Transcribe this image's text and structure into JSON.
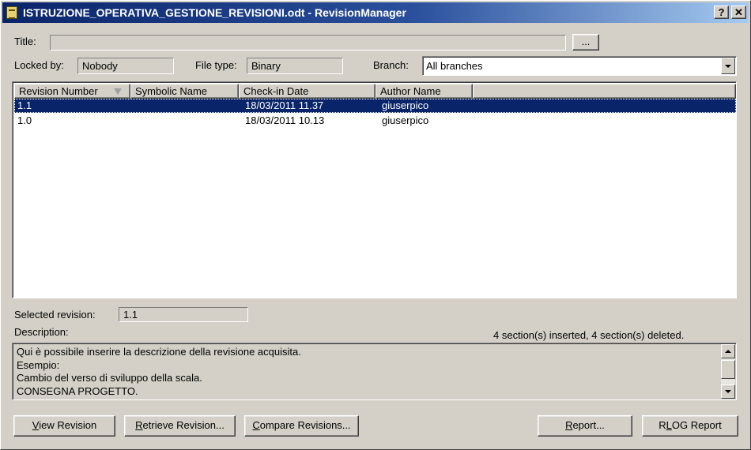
{
  "window": {
    "title": "ISTRUZIONE_OPERATIVA_GESTIONE_REVISIONI.odt - RevisionManager",
    "help_label": "?",
    "close_label": "✕"
  },
  "fields": {
    "title_label": "Title:",
    "title_value": "",
    "browse_label": "...",
    "locked_by_label": "Locked by:",
    "locked_by_value": "Nobody",
    "file_type_label": "File type:",
    "file_type_value": "Binary",
    "branch_label": "Branch:",
    "branch_value": "All branches"
  },
  "revisions": {
    "columns": [
      "Revision Number",
      "Symbolic Name",
      "Check-in Date",
      "Author Name"
    ],
    "rows": [
      {
        "revision": "1.1",
        "symbolic": "",
        "date": "18/03/2011 11.37",
        "author": "giuserpico",
        "selected": true
      },
      {
        "revision": "1.0",
        "symbolic": "",
        "date": "18/03/2011 10.13",
        "author": "giuserpico",
        "selected": false
      }
    ]
  },
  "selection": {
    "selected_revision_label": "Selected revision:",
    "selected_revision_value": "1.1",
    "description_label": "Description:",
    "changes_summary": "4 section(s) inserted, 4 section(s) deleted.",
    "description_lines": [
      "Qui è possibile inserire la descrizione della revisione acquisita.",
      "Esempio:",
      "Cambio del verso di sviluppo della scala.",
      "CONSEGNA PROGETTO."
    ]
  },
  "buttons": {
    "view_revision_acc": "V",
    "view_revision_rest": "iew Revision",
    "retrieve_revision_acc": "R",
    "retrieve_revision_rest": "etrieve Revision...",
    "compare_revisions_acc": "C",
    "compare_revisions_rest": "ompare Revisions...",
    "report_acc": "R",
    "report_rest": "eport...",
    "rlog_report_pre": "R",
    "rlog_report_acc": "L",
    "rlog_report_rest": "OG Report"
  }
}
